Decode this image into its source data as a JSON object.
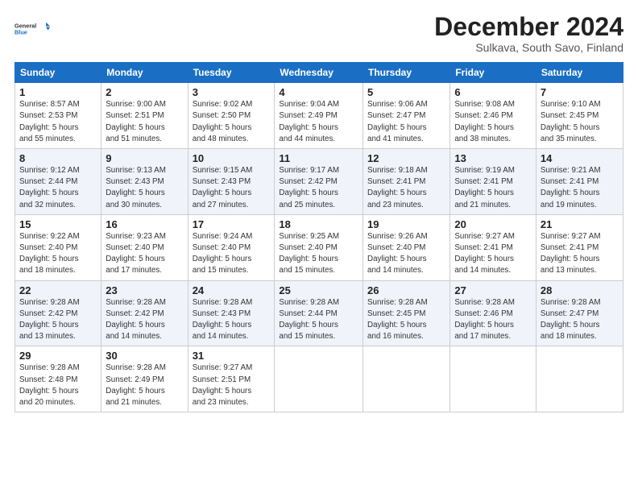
{
  "logo": {
    "line1": "General",
    "line2": "Blue"
  },
  "title": "December 2024",
  "subtitle": "Sulkava, South Savo, Finland",
  "header": {
    "days": [
      "Sunday",
      "Monday",
      "Tuesday",
      "Wednesday",
      "Thursday",
      "Friday",
      "Saturday"
    ]
  },
  "weeks": [
    [
      {
        "num": "1",
        "info": "Sunrise: 8:57 AM\nSunset: 2:53 PM\nDaylight: 5 hours\nand 55 minutes."
      },
      {
        "num": "2",
        "info": "Sunrise: 9:00 AM\nSunset: 2:51 PM\nDaylight: 5 hours\nand 51 minutes."
      },
      {
        "num": "3",
        "info": "Sunrise: 9:02 AM\nSunset: 2:50 PM\nDaylight: 5 hours\nand 48 minutes."
      },
      {
        "num": "4",
        "info": "Sunrise: 9:04 AM\nSunset: 2:49 PM\nDaylight: 5 hours\nand 44 minutes."
      },
      {
        "num": "5",
        "info": "Sunrise: 9:06 AM\nSunset: 2:47 PM\nDaylight: 5 hours\nand 41 minutes."
      },
      {
        "num": "6",
        "info": "Sunrise: 9:08 AM\nSunset: 2:46 PM\nDaylight: 5 hours\nand 38 minutes."
      },
      {
        "num": "7",
        "info": "Sunrise: 9:10 AM\nSunset: 2:45 PM\nDaylight: 5 hours\nand 35 minutes."
      }
    ],
    [
      {
        "num": "8",
        "info": "Sunrise: 9:12 AM\nSunset: 2:44 PM\nDaylight: 5 hours\nand 32 minutes."
      },
      {
        "num": "9",
        "info": "Sunrise: 9:13 AM\nSunset: 2:43 PM\nDaylight: 5 hours\nand 30 minutes."
      },
      {
        "num": "10",
        "info": "Sunrise: 9:15 AM\nSunset: 2:43 PM\nDaylight: 5 hours\nand 27 minutes."
      },
      {
        "num": "11",
        "info": "Sunrise: 9:17 AM\nSunset: 2:42 PM\nDaylight: 5 hours\nand 25 minutes."
      },
      {
        "num": "12",
        "info": "Sunrise: 9:18 AM\nSunset: 2:41 PM\nDaylight: 5 hours\nand 23 minutes."
      },
      {
        "num": "13",
        "info": "Sunrise: 9:19 AM\nSunset: 2:41 PM\nDaylight: 5 hours\nand 21 minutes."
      },
      {
        "num": "14",
        "info": "Sunrise: 9:21 AM\nSunset: 2:41 PM\nDaylight: 5 hours\nand 19 minutes."
      }
    ],
    [
      {
        "num": "15",
        "info": "Sunrise: 9:22 AM\nSunset: 2:40 PM\nDaylight: 5 hours\nand 18 minutes."
      },
      {
        "num": "16",
        "info": "Sunrise: 9:23 AM\nSunset: 2:40 PM\nDaylight: 5 hours\nand 17 minutes."
      },
      {
        "num": "17",
        "info": "Sunrise: 9:24 AM\nSunset: 2:40 PM\nDaylight: 5 hours\nand 15 minutes."
      },
      {
        "num": "18",
        "info": "Sunrise: 9:25 AM\nSunset: 2:40 PM\nDaylight: 5 hours\nand 15 minutes."
      },
      {
        "num": "19",
        "info": "Sunrise: 9:26 AM\nSunset: 2:40 PM\nDaylight: 5 hours\nand 14 minutes."
      },
      {
        "num": "20",
        "info": "Sunrise: 9:27 AM\nSunset: 2:41 PM\nDaylight: 5 hours\nand 14 minutes."
      },
      {
        "num": "21",
        "info": "Sunrise: 9:27 AM\nSunset: 2:41 PM\nDaylight: 5 hours\nand 13 minutes."
      }
    ],
    [
      {
        "num": "22",
        "info": "Sunrise: 9:28 AM\nSunset: 2:42 PM\nDaylight: 5 hours\nand 13 minutes."
      },
      {
        "num": "23",
        "info": "Sunrise: 9:28 AM\nSunset: 2:42 PM\nDaylight: 5 hours\nand 14 minutes."
      },
      {
        "num": "24",
        "info": "Sunrise: 9:28 AM\nSunset: 2:43 PM\nDaylight: 5 hours\nand 14 minutes."
      },
      {
        "num": "25",
        "info": "Sunrise: 9:28 AM\nSunset: 2:44 PM\nDaylight: 5 hours\nand 15 minutes."
      },
      {
        "num": "26",
        "info": "Sunrise: 9:28 AM\nSunset: 2:45 PM\nDaylight: 5 hours\nand 16 minutes."
      },
      {
        "num": "27",
        "info": "Sunrise: 9:28 AM\nSunset: 2:46 PM\nDaylight: 5 hours\nand 17 minutes."
      },
      {
        "num": "28",
        "info": "Sunrise: 9:28 AM\nSunset: 2:47 PM\nDaylight: 5 hours\nand 18 minutes."
      }
    ],
    [
      {
        "num": "29",
        "info": "Sunrise: 9:28 AM\nSunset: 2:48 PM\nDaylight: 5 hours\nand 20 minutes."
      },
      {
        "num": "30",
        "info": "Sunrise: 9:28 AM\nSunset: 2:49 PM\nDaylight: 5 hours\nand 21 minutes."
      },
      {
        "num": "31",
        "info": "Sunrise: 9:27 AM\nSunset: 2:51 PM\nDaylight: 5 hours\nand 23 minutes."
      },
      null,
      null,
      null,
      null
    ]
  ]
}
